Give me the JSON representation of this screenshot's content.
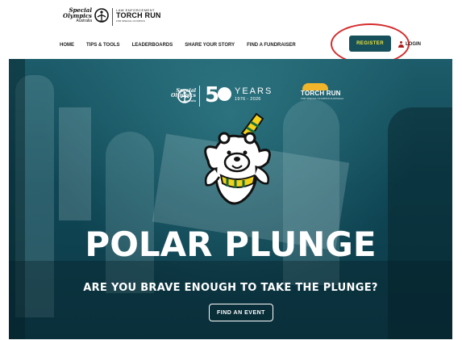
{
  "header": {
    "special_olympics_line1": "Special",
    "special_olympics_line2": "Olympics",
    "special_olympics_sub": "Australia",
    "torch_run_small": "LAW ENFORCEMENT",
    "torch_run_name": "TORCH RUN",
    "torch_run_tiny": "FOR SPECIAL OLYMPICS"
  },
  "nav": {
    "items": [
      {
        "label": "HOME"
      },
      {
        "label": "TIPS & TOOLS"
      },
      {
        "label": "LEADERBOARDS"
      },
      {
        "label": "SHARE YOUR STORY"
      },
      {
        "label": "FIND A FUNDRAISER"
      }
    ],
    "register_label": "REGISTER",
    "login_label": "LOGIN"
  },
  "hero": {
    "so_line1": "Special",
    "so_line2": "Olympics",
    "so_sub": "Australia",
    "anniversary_years_label": "YEARS",
    "anniversary_dates": "1976 - 2026",
    "torch_run_name": "TORCH RUN",
    "torch_run_tiny": "FOR SPECIAL OLYMPICS AUSTRALIA",
    "title": "POLAR PLUNGE",
    "tagline": "ARE YOU BRAVE ENOUGH TO TAKE THE PLUNGE?",
    "cta_label": "FIND AN EVENT"
  },
  "colors": {
    "register_bg": "#17505b",
    "register_text": "#f0e33a",
    "highlight": "#d62b2b",
    "hero_bg": "#0f4655"
  }
}
